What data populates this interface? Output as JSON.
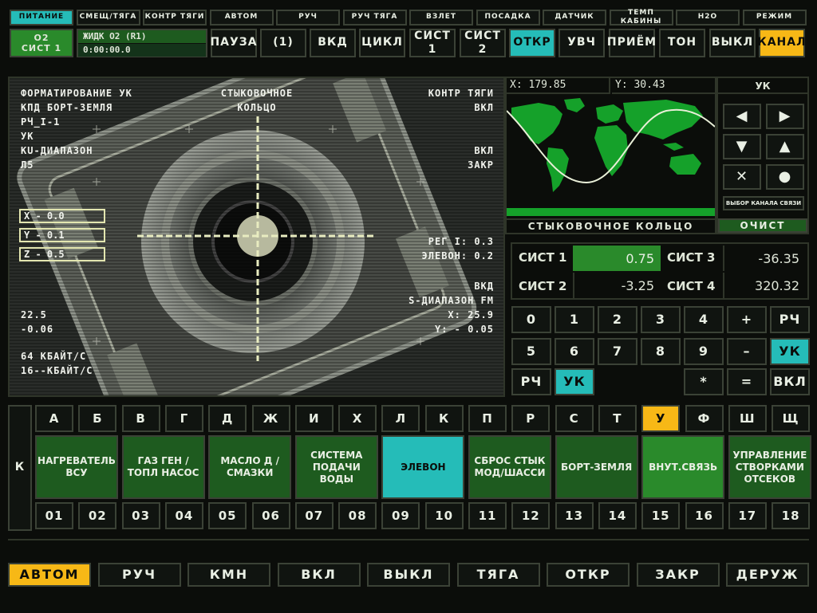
{
  "top_tabs": [
    "ПИТАНИЕ",
    "СМЕЩ/ТЯГА",
    "КОНТР ТЯГИ",
    "АВТОМ",
    "РУЧ",
    "РУЧ ТЯГА",
    "ВЗЛЕТ",
    "ПОСАДКА",
    "ДАТЧИК",
    "ТЕМП КАБИНЫ",
    "H2O",
    "РЕЖИМ"
  ],
  "status": {
    "o2": "O2",
    "sys": "СИСТ 1",
    "liquid": "ЖИДК О2 (R1)",
    "timer": "0:00:00.0"
  },
  "controls": [
    "ПАУЗА",
    "(1)",
    "ВКД",
    "ЦИКЛ",
    "СИСТ 1",
    "СИСТ 2",
    "ОТКР",
    "УВЧ",
    "ПРИЁМ",
    "ТОН",
    "ВЫКЛ",
    "КАНАЛ"
  ],
  "camera": {
    "left_lines": [
      "ФОРМАТИРОВАНИЕ УК",
      "КПД БОРТ-ЗЕМЛЯ",
      "РЧ_I-1",
      "УК",
      "KU-ДИАПАЗОН",
      "Л5"
    ],
    "title": [
      "СТЫКОВОЧНОЕ",
      "КОЛЬЦО"
    ],
    "right_lines": [
      "КОНТР ТЯГИ",
      "ВКЛ",
      "",
      "",
      "ВКЛ",
      "ЗАКР"
    ],
    "coords": [
      "X - 0.0",
      "Y - 0.1",
      "Z - 0.5"
    ],
    "right_mid": [
      "РЕГ I: 0.3",
      "ЭЛЕВОН: 0.2"
    ],
    "right_low": [
      "ВКД",
      "S-ДИАПАЗОН FM",
      "X: 25.9",
      "Y: - 0.05"
    ],
    "left_low": [
      "22.5",
      "-0.06"
    ],
    "left_rates": [
      "64 КБАЙТ/С",
      "16--КБАЙТ/С"
    ]
  },
  "map": {
    "x_readout": "X: 179.85",
    "y_readout": "Y: 30.43",
    "label": "СТЫКОВОЧНОЕ КОЛЬЦО",
    "clear": "ОЧИСТ"
  },
  "uk": {
    "title": "УК",
    "channel_select": "ВЫБОР КАНАЛА СВЯЗИ",
    "icons": [
      "arrow-left-icon",
      "arrow-right-icon",
      "arrow-down-icon",
      "arrow-up-icon",
      "cross-icon",
      "dot-icon"
    ]
  },
  "readouts": [
    {
      "label": "СИСТ 1",
      "value": "0.75"
    },
    {
      "label": "СИСТ 3",
      "value": "-36.35"
    },
    {
      "label": "СИСТ 2",
      "value": "-3.25"
    },
    {
      "label": "СИСТ 4",
      "value": "320.32"
    }
  ],
  "keypad": {
    "row1": [
      "0",
      "1",
      "2",
      "3",
      "4",
      "+",
      "РЧ"
    ],
    "row2": [
      "5",
      "6",
      "7",
      "8",
      "9",
      "–",
      "УК"
    ],
    "row3": [
      "РЧ",
      "УК",
      "*",
      "=",
      "ВКЛ"
    ]
  },
  "letters": [
    "А",
    "Б",
    "В",
    "Г",
    "Д",
    "Ж",
    "И",
    "Х",
    "Л",
    "К",
    "П",
    "Р",
    "С",
    "Т",
    "У",
    "Ф",
    "Ш",
    "Щ"
  ],
  "row_label": "К",
  "modules": [
    "НАГРЕВАТЕЛЬ ВСУ",
    "ГАЗ ГЕН / ТОПЛ НАСОС",
    "МАСЛО Д / СМАЗКИ",
    "СИСТЕМА ПОДАЧИ ВОДЫ",
    "ЭЛЕВОН",
    "СБРОС СТЫК МОД/ШАССИ",
    "БОРТ-ЗЕМЛЯ",
    "ВНУТ.СВЯЗЬ",
    "УПРАВЛЕНИЕ СТВОРКАМИ ОТСЕКОВ"
  ],
  "numbers": [
    "01",
    "02",
    "03",
    "04",
    "05",
    "06",
    "07",
    "08",
    "09",
    "10",
    "11",
    "12",
    "13",
    "14",
    "15",
    "16",
    "17",
    "18"
  ],
  "bottom": [
    "АВТОМ",
    "РУЧ",
    "КМН",
    "ВКЛ",
    "ВЫКЛ",
    "ТЯГА",
    "ОТКР",
    "ЗАКР",
    "ДЕРУЖ"
  ],
  "colors": {
    "cyan": "#25bcb8",
    "amber": "#f7b816",
    "green": "#1e5b1f",
    "bright_green": "#2a8a2b",
    "map_land": "#15a12a"
  }
}
